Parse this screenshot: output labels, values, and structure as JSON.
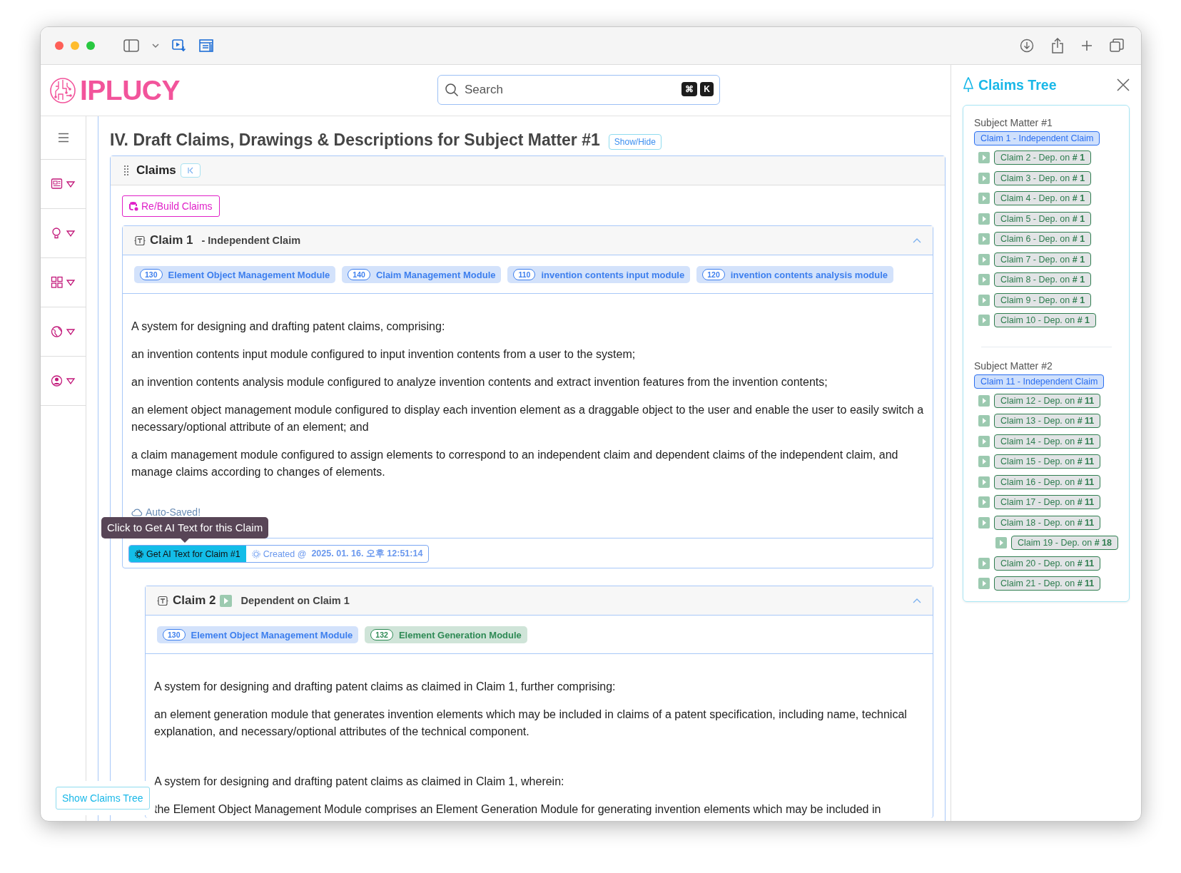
{
  "app": {
    "logo_text": "IPLUCY"
  },
  "search": {
    "placeholder": "Search",
    "shortcut_keys": [
      "⌘",
      "K"
    ]
  },
  "section": {
    "title": "IV. Draft Claims, Drawings & Descriptions for Subject Matter #1",
    "toggle_label": "Show/Hide"
  },
  "claims_panel": {
    "title": "Claims",
    "rebuild_label": "Re/Build Claims"
  },
  "claims": [
    {
      "number_label": "Claim 1",
      "kind": "independent",
      "relation": "- Independent Claim",
      "expanded": true,
      "elements": [
        {
          "code": "130",
          "name": "Element Object Management Module",
          "color": "#3d7fee"
        },
        {
          "code": "140",
          "name": "Claim Management Module",
          "color": "#3d7fee"
        },
        {
          "code": "110",
          "name": "invention contents input module",
          "color": "#3d7fee"
        },
        {
          "code": "120",
          "name": "invention contents analysis module",
          "color": "#3d7fee"
        }
      ],
      "text_blocks": [
        [
          "A system for designing and drafting patent claims, comprising:",
          "an invention contents input module configured to input invention contents from a user to the system;",
          "an invention contents analysis module configured to analyze invention contents and extract invention features from the invention contents;",
          "an element object management module configured to display each invention element as a draggable object to the user and enable the user to easily switch a necessary/optional attribute of an element; and",
          "a claim management module configured to assign elements to correspond to an independent claim and dependent claims of the independent claim, and manage claims according to changes of elements."
        ]
      ],
      "auto_saved": "Auto-Saved!",
      "tooltip": "Click to Get AI Text for this Claim",
      "ai_button": "Get AI Text for Claim #1",
      "created_label": "Created @",
      "created_at": "2025. 01. 16. 오후 12:51:14"
    },
    {
      "number_label": "Claim 2",
      "kind": "dependent",
      "relation": "Dependent on **Claim 1**",
      "expanded": true,
      "elements": [
        {
          "code": "130",
          "name": "Element Object Management Module",
          "color": "#3d7fee"
        },
        {
          "code": "132",
          "name": "Element Generation Module",
          "color": "#2e8a55"
        }
      ],
      "text_blocks": [
        [
          "A system for designing and drafting patent claims as claimed in Claim 1, further comprising:",
          "an element generation module that generates invention elements which may be included in claims of a patent specification, including name, technical explanation, and necessary/optional attributes of the technical component."
        ],
        [
          "A system for designing and drafting patent claims as claimed in Claim 1, wherein:",
          "the Element Object Management Module comprises an Element Generation Module for generating invention elements which may be included in"
        ]
      ]
    }
  ],
  "claims_tree": {
    "title": "Claims Tree",
    "groups": [
      {
        "title": "Subject Matter #1",
        "root": "Claim 1 - Independent Claim",
        "children": [
          {
            "label": "Claim 2 - Dep. on **# 1**"
          },
          {
            "label": "Claim 3 - Dep. on **# 1**"
          },
          {
            "label": "Claim 4 - Dep. on **# 1**"
          },
          {
            "label": "Claim 5 - Dep. on **# 1**"
          },
          {
            "label": "Claim 6 - Dep. on **# 1**"
          },
          {
            "label": "Claim 7 - Dep. on **# 1**"
          },
          {
            "label": "Claim 8 - Dep. on **# 1**"
          },
          {
            "label": "Claim 9 - Dep. on **# 1**"
          },
          {
            "label": "Claim 10 - Dep. on **# 1**"
          }
        ]
      },
      {
        "title": "Subject Matter #2",
        "root": "Claim 11 - Independent Claim",
        "children": [
          {
            "label": "Claim 12 - Dep. on **# 11**"
          },
          {
            "label": "Claim 13 - Dep. on **# 11**"
          },
          {
            "label": "Claim 14 - Dep. on **# 11**"
          },
          {
            "label": "Claim 15 - Dep. on **# 11**"
          },
          {
            "label": "Claim 16 - Dep. on **# 11**"
          },
          {
            "label": "Claim 17 - Dep. on **# 11**"
          },
          {
            "label": "Claim 18 - Dep. on **# 11**",
            "children": [
              {
                "label": "Claim 19 - Dep. on **# 18**"
              }
            ]
          },
          {
            "label": "Claim 20 - Dep. on **# 11**"
          },
          {
            "label": "Claim 21 - Dep. on **# 11**"
          }
        ]
      }
    ]
  },
  "show_tree_button": "Show Claims Tree"
}
